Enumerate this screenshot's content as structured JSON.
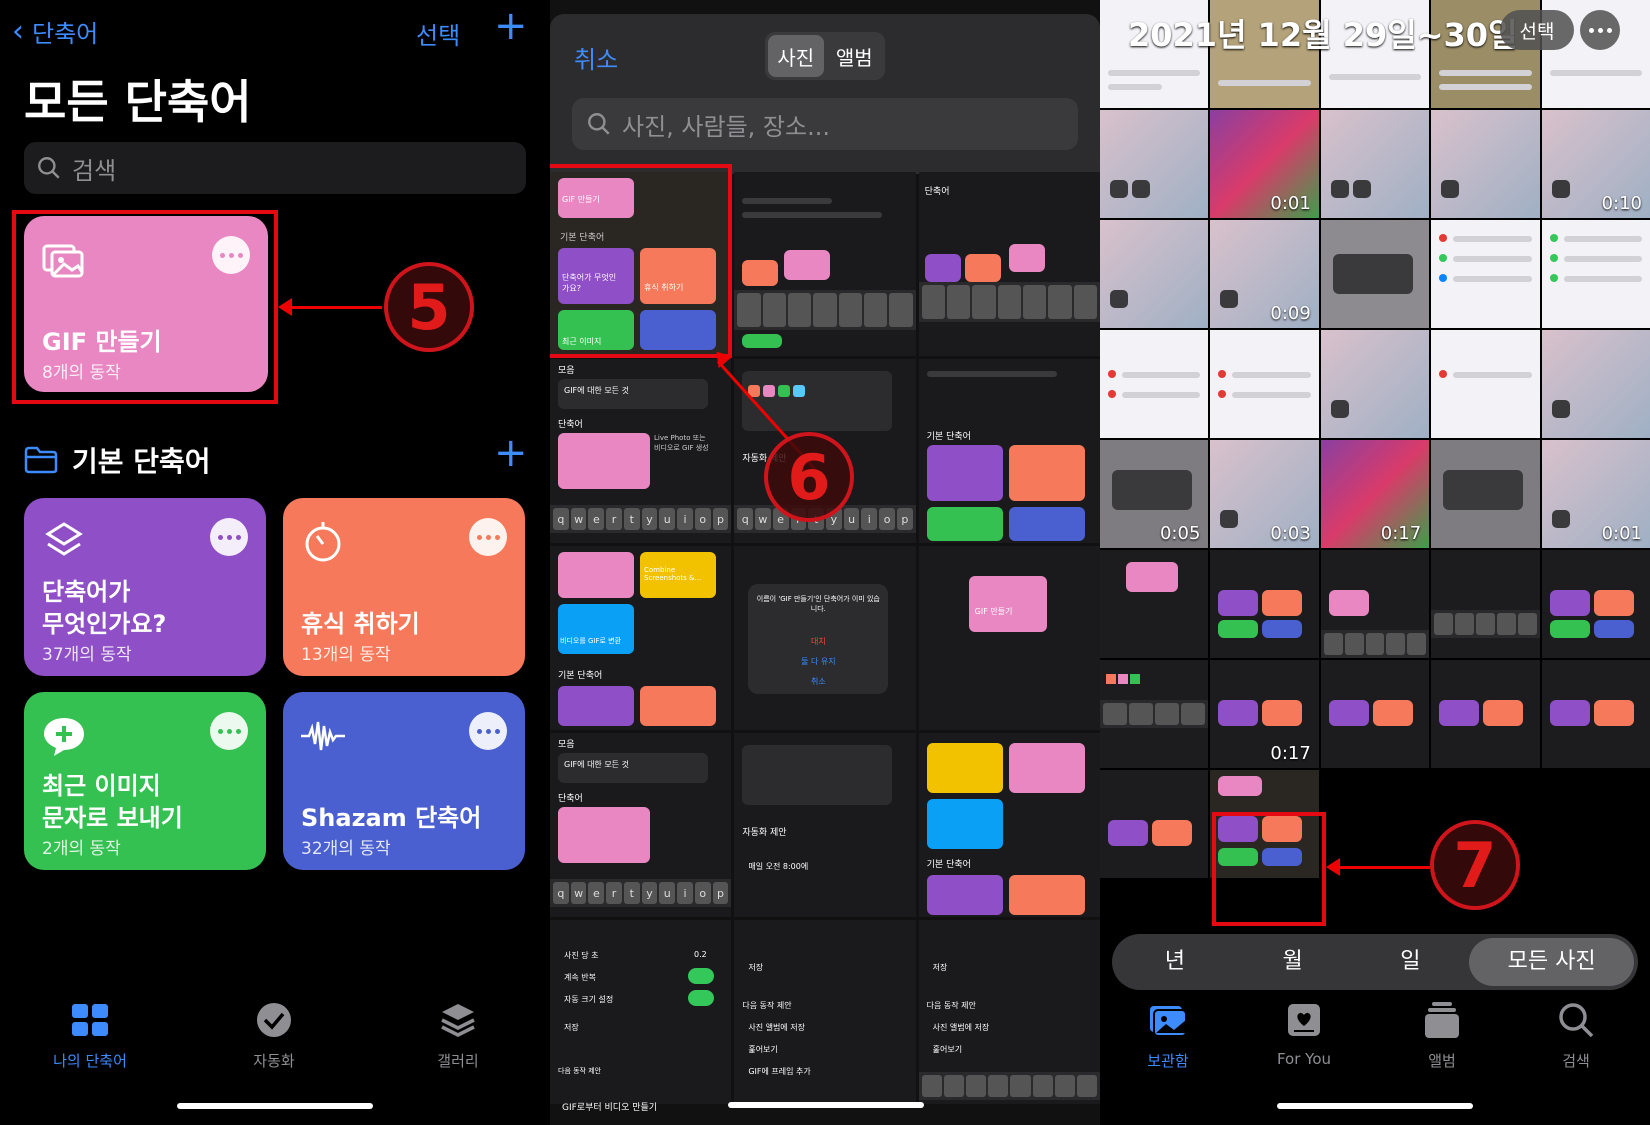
{
  "panel1": {
    "back_label": "단축어",
    "select_label": "선택",
    "plus_label": "+",
    "title": "모든 단축어",
    "search_placeholder": "검색",
    "featured": {
      "title": "GIF 만들기",
      "subtitle": "8개의 동작",
      "color": "#e887c2"
    },
    "step_badge": "5",
    "section_title": "기본 단축어",
    "tiles": [
      {
        "title": "단축어가\n무엇인가요?",
        "subtitle": "37개의 동작",
        "color": "#8e4fc7",
        "icon": "layers-icon"
      },
      {
        "title": "휴식 취하기",
        "subtitle": "13개의 동작",
        "color": "#f5795a",
        "icon": "timer-icon"
      },
      {
        "title": "최근 이미지\n문자로 보내기",
        "subtitle": "2개의 동작",
        "color": "#34c152",
        "icon": "message-plus-icon"
      },
      {
        "title": "Shazam 단축어",
        "subtitle": "32개의 동작",
        "color": "#4a5fd0",
        "icon": "waveform-icon"
      }
    ],
    "tabs": [
      {
        "label": "나의 단축어",
        "icon": "grid-icon",
        "active": true
      },
      {
        "label": "자동화",
        "icon": "check-clock-icon",
        "active": false
      },
      {
        "label": "갤러리",
        "icon": "stack-icon",
        "active": false
      }
    ]
  },
  "panel2": {
    "cancel_label": "취소",
    "segments": [
      "사진",
      "앨범"
    ],
    "search_placeholder": "사진, 사람들, 장소...",
    "step_badge": "6",
    "thumb_texts": {
      "gif": "GIF 만들기",
      "basic": "기본 단축어",
      "what": "단축어가 무엇인가요?",
      "rest": "휴식 취하기",
      "recent": "최근 이미지",
      "collection": "모음",
      "shortcuts": "단축어",
      "all_gif": "GIF에 대한 모든 것",
      "auto_suggest": "자동화 제안",
      "combine": "Combine Screenshots &...",
      "video_gif": "비디오를 GIF로 변환",
      "dialog": "이름이 'GIF 만들기'인 단축어가 이미 있습니다.",
      "dialog_replace": "대치",
      "dialog_keep": "둘 다 유지",
      "dialog_cancel": "취소",
      "morning": "매일 오전 8:00에",
      "per_photo": "사진 당 초",
      "loop": "계속 반복",
      "auto_size": "자동 크기 설정",
      "save": "저장",
      "next_action": "다음 동작 제안",
      "save_album": "사진 앨범에 저장",
      "preview": "훑어보기",
      "add_frame": "GIF에 프레임 추가",
      "make_video": "GIF로부터 비디오 만들기",
      "live_photo": "Live Photo 또는 비디오로 GIF 생성",
      "value_02": "0.2",
      "keys": [
        "q",
        "w",
        "e",
        "r",
        "t",
        "y",
        "u",
        "i",
        "o",
        "p"
      ]
    }
  },
  "panel3": {
    "date_range": "2021년 12월 29일~30일",
    "select_label": "선택",
    "durations": [
      "0:01",
      "0:10",
      "0:09",
      "0:05",
      "0:03",
      "0:17",
      "0:01",
      "0:17"
    ],
    "step_badge": "7",
    "segments": [
      "년",
      "월",
      "일",
      "모든 사진"
    ],
    "tabs": [
      {
        "label": "보관함",
        "icon": "photo-library-icon",
        "active": true
      },
      {
        "label": "For You",
        "icon": "for-you-icon",
        "active": false
      },
      {
        "label": "앨범",
        "icon": "albums-icon",
        "active": false
      },
      {
        "label": "검색",
        "icon": "search-icon",
        "active": false
      }
    ]
  },
  "colors": {
    "accent": "#3d8bfd",
    "highlight": "#e50914"
  }
}
